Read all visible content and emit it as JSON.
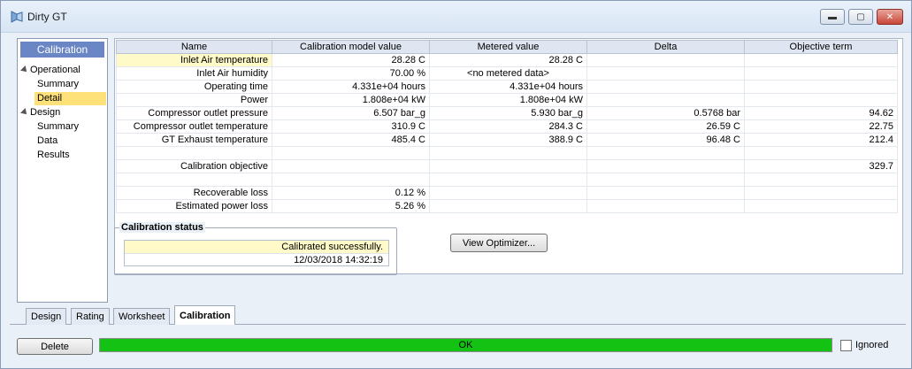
{
  "window": {
    "title": "Dirty GT",
    "minimize_glyph": "▬",
    "restore_glyph": "▢",
    "close_glyph": "✕"
  },
  "nav": {
    "header": "Calibration",
    "items": [
      {
        "label": "Operational",
        "level": 0,
        "group": true
      },
      {
        "label": "Summary",
        "level": 1
      },
      {
        "label": "Detail",
        "level": 1,
        "selected": true
      },
      {
        "label": "Design",
        "level": 0,
        "group": true
      },
      {
        "label": "Summary",
        "level": 1
      },
      {
        "label": "Data",
        "level": 1
      },
      {
        "label": "Results",
        "level": 1
      }
    ]
  },
  "grid": {
    "columns": [
      "Name",
      "Calibration model value",
      "Metered value",
      "Delta",
      "Objective term"
    ],
    "rows": [
      {
        "name": "Inlet Air temperature",
        "model": "28.28 C",
        "metered": "28.28 C",
        "delta": "",
        "objective": ""
      },
      {
        "name": "Inlet Air humidity",
        "model": "70.00 %",
        "metered": "<no metered data>",
        "delta": "",
        "objective": ""
      },
      {
        "name": "Operating time",
        "model": "4.331e+04 hours",
        "metered": "4.331e+04 hours",
        "delta": "",
        "objective": ""
      },
      {
        "name": "Power",
        "model": "1.808e+04 kW",
        "metered": "1.808e+04 kW",
        "delta": "",
        "objective": ""
      },
      {
        "name": "Compressor outlet pressure",
        "model": "6.507 bar_g",
        "metered": "5.930 bar_g",
        "delta": "0.5768 bar",
        "objective": "94.62"
      },
      {
        "name": "Compressor outlet temperature",
        "model": "310.9 C",
        "metered": "284.3 C",
        "delta": "26.59 C",
        "objective": "22.75"
      },
      {
        "name": "GT Exhaust temperature",
        "model": "485.4 C",
        "metered": "388.9 C",
        "delta": "96.48 C",
        "objective": "212.4"
      },
      {
        "name": "",
        "model": "",
        "metered": "",
        "delta": "",
        "objective": ""
      },
      {
        "name": "Calibration objective",
        "model": "",
        "metered": "",
        "delta": "",
        "objective": "329.7"
      },
      {
        "name": "",
        "model": "",
        "metered": "",
        "delta": "",
        "objective": ""
      },
      {
        "name": "Recoverable loss",
        "model": "0.12 %",
        "metered": "",
        "delta": "",
        "objective": ""
      },
      {
        "name": "Estimated power loss",
        "model": "5.26 %",
        "metered": "",
        "delta": "",
        "objective": ""
      }
    ]
  },
  "status": {
    "label": "Calibration status",
    "message": "Calibrated successfully.",
    "timestamp": "12/03/2018 14:32:19"
  },
  "buttons": {
    "view_optimizer": "View Optimizer...",
    "delete": "Delete"
  },
  "tabs": [
    {
      "label": "Design",
      "active": false
    },
    {
      "label": "Rating",
      "active": false
    },
    {
      "label": "Worksheet",
      "active": false
    },
    {
      "label": "Calibration",
      "active": true
    }
  ],
  "footer": {
    "progress_text": "OK",
    "progress_fraction": 1.0,
    "progress_color": "#13c213",
    "ignored_label": "Ignored",
    "ignored_checked": false
  }
}
